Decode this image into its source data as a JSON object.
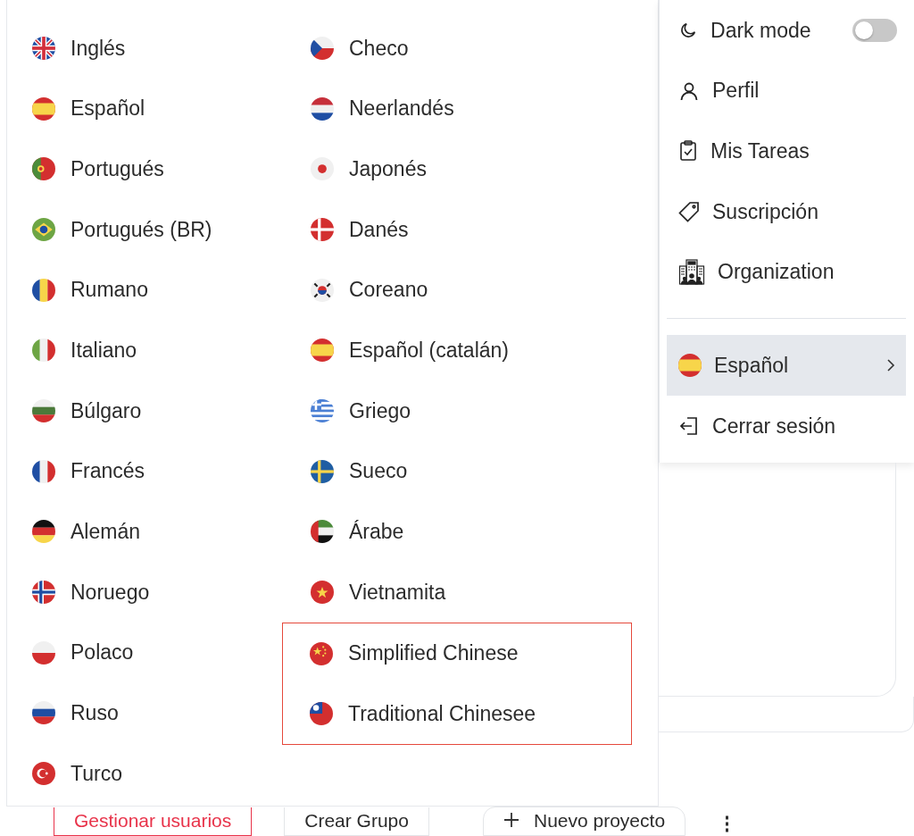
{
  "language_menu": {
    "columns": [
      [
        {
          "label": "Inglés",
          "highlighted": false
        },
        {
          "label": "Español",
          "highlighted": false
        },
        {
          "label": "Portugués",
          "highlighted": false
        },
        {
          "label": "Portugués (BR)",
          "highlighted": false
        },
        {
          "label": "Rumano",
          "highlighted": false
        },
        {
          "label": "Italiano",
          "highlighted": false
        },
        {
          "label": "Búlgaro",
          "highlighted": false
        },
        {
          "label": "Francés",
          "highlighted": false
        },
        {
          "label": "Alemán",
          "highlighted": false
        },
        {
          "label": "Noruego",
          "highlighted": false
        },
        {
          "label": "Polaco",
          "highlighted": false
        },
        {
          "label": "Ruso",
          "highlighted": false
        },
        {
          "label": "Turco",
          "highlighted": false
        }
      ],
      [
        {
          "label": "Checo",
          "highlighted": false
        },
        {
          "label": "Neerlandés",
          "highlighted": false
        },
        {
          "label": "Japonés",
          "highlighted": false
        },
        {
          "label": "Danés",
          "highlighted": false
        },
        {
          "label": "Coreano",
          "highlighted": false
        },
        {
          "label": "Español (catalán)",
          "highlighted": false
        },
        {
          "label": "Griego",
          "highlighted": false
        },
        {
          "label": "Sueco",
          "highlighted": false
        },
        {
          "label": "Árabe",
          "highlighted": false
        },
        {
          "label": "Vietnamita",
          "highlighted": false
        },
        {
          "label": "Simplified Chinese",
          "highlighted": true
        },
        {
          "label": "Traditional Chinesee",
          "highlighted": true
        }
      ]
    ]
  },
  "user_menu": {
    "items": [
      {
        "kind": "toggle",
        "label": "Dark mode",
        "on": false
      },
      {
        "kind": "link",
        "label": "Perfil"
      },
      {
        "kind": "link",
        "label": "Mis Tareas"
      },
      {
        "kind": "link",
        "label": "Suscripción"
      },
      {
        "kind": "link",
        "label": "Organization"
      },
      {
        "kind": "divider"
      },
      {
        "kind": "language",
        "label": "Español",
        "selected": true
      },
      {
        "kind": "link",
        "label": "Cerrar sesión"
      }
    ]
  },
  "toolbar": {
    "buttons": [
      {
        "kind": "danger",
        "label": "Gestionar usuarios"
      },
      {
        "kind": "plain",
        "label": "Crear Grupo"
      },
      {
        "kind": "add",
        "label": "Nuevo proyecto"
      },
      {
        "kind": "more",
        "label": "⋮"
      }
    ]
  }
}
